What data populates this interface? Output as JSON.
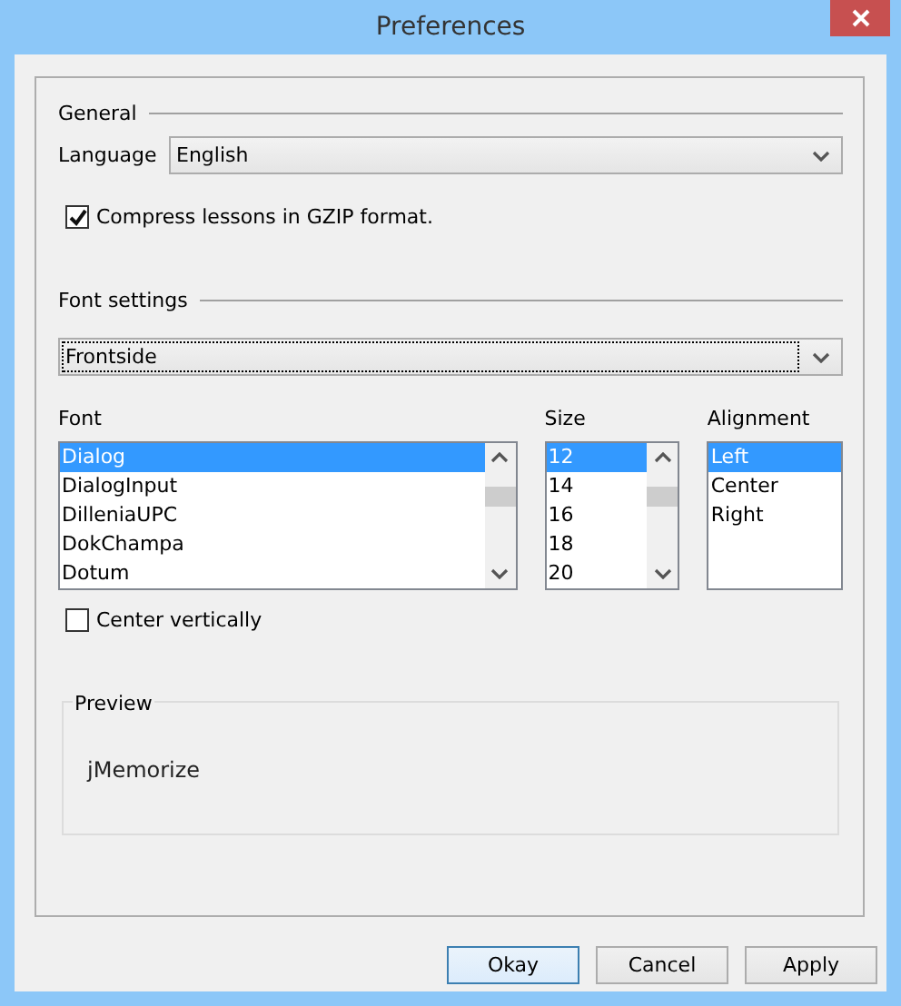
{
  "window": {
    "title": "Preferences"
  },
  "general": {
    "heading": "General",
    "language_label": "Language",
    "language_value": "English",
    "compress": {
      "label": "Compress lessons in GZIP format.",
      "checked": true
    }
  },
  "font_settings": {
    "heading": "Font settings",
    "side_value": "Frontside",
    "lists": [
      {
        "label": "Font",
        "scrollbar": true,
        "items": [
          {
            "text": "Dialog",
            "selected": true
          },
          {
            "text": "DialogInput",
            "selected": false
          },
          {
            "text": "DilleniaUPC",
            "selected": false
          },
          {
            "text": "DokChampa",
            "selected": false
          },
          {
            "text": "Dotum",
            "selected": false
          }
        ]
      },
      {
        "label": "Size",
        "scrollbar": true,
        "items": [
          {
            "text": "12",
            "selected": true
          },
          {
            "text": "14",
            "selected": false
          },
          {
            "text": "16",
            "selected": false
          },
          {
            "text": "18",
            "selected": false
          },
          {
            "text": "20",
            "selected": false
          }
        ]
      },
      {
        "label": "Alignment",
        "scrollbar": false,
        "items": [
          {
            "text": "Left",
            "selected": true
          },
          {
            "text": "Center",
            "selected": false
          },
          {
            "text": "Right",
            "selected": false
          }
        ]
      }
    ],
    "center_vertically": {
      "label": "Center vertically",
      "checked": false
    }
  },
  "preview": {
    "heading": "Preview",
    "sample": "jMemorize"
  },
  "buttons": [
    {
      "label": "Okay",
      "default": true
    },
    {
      "label": "Cancel",
      "default": false
    },
    {
      "label": "Apply",
      "default": false
    }
  ]
}
